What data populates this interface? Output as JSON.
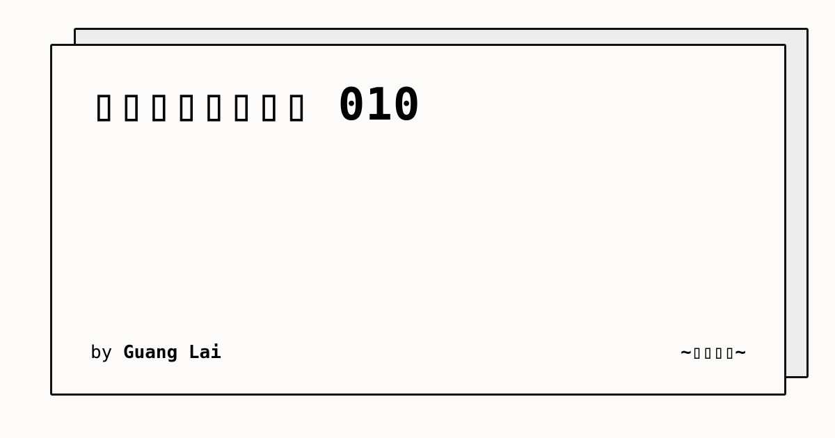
{
  "card": {
    "title": "▯▯▯▯▯▯▯▯ 010",
    "by_label": "by",
    "author": "Guang Lai",
    "tag": "~▯▯▯▯~"
  }
}
